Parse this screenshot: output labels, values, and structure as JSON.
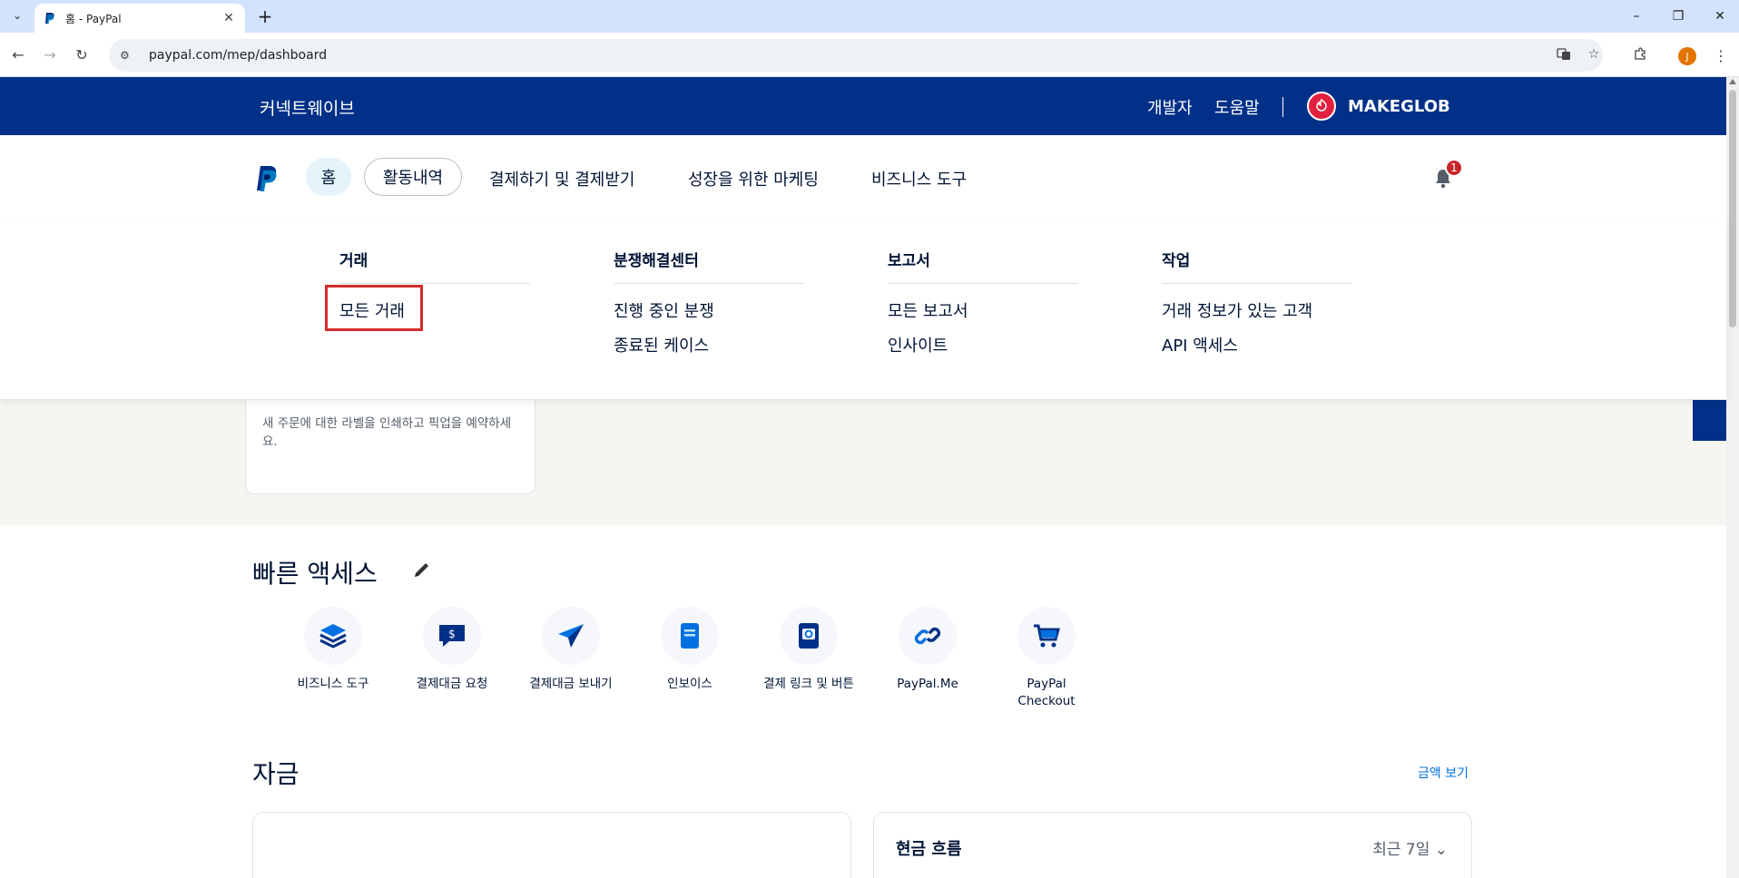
{
  "browser": {
    "tab_title": "홈 - PayPal",
    "url": "paypal.com/mep/dashboard",
    "profile_initial": "J"
  },
  "topbar": {
    "brand": "커넥트웨이브",
    "developer": "개발자",
    "help": "도움말",
    "merchant": "MAKEGLOB"
  },
  "nav": {
    "home": "홈",
    "activity": "활동내역",
    "payments": "결제하기 및 결제받기",
    "marketing": "성장을 위한 마케팅",
    "business_tools": "비즈니스 도구",
    "notifications_count": "1"
  },
  "megamenu": {
    "columns": [
      {
        "title": "거래",
        "items": [
          "모든 거래"
        ]
      },
      {
        "title": "분쟁해결센터",
        "items": [
          "진행 중인 분쟁",
          "종료된 케이스"
        ]
      },
      {
        "title": "보고서",
        "items": [
          "모든 보고서",
          "인사이트"
        ]
      },
      {
        "title": "작업",
        "items": [
          "거래 정보가 있는 고객",
          "API 액세스"
        ]
      }
    ]
  },
  "shipping_card": {
    "description": "새 주문에 대한 라벨을 인쇄하고 픽업을 예약하세요."
  },
  "quick_access": {
    "title": "빠른 액세스",
    "items": [
      {
        "label": "비즈니스 도구",
        "icon": "layers-icon"
      },
      {
        "label": "결제대금 요청",
        "icon": "request-money-icon"
      },
      {
        "label": "결제대금 보내기",
        "icon": "send-money-icon"
      },
      {
        "label": "인보이스",
        "icon": "invoice-icon"
      },
      {
        "label": "결제 링크 및 버튼",
        "icon": "payment-link-icon"
      },
      {
        "label": "PayPal.Me",
        "icon": "link-icon"
      },
      {
        "label": "PayPal Checkout",
        "icon": "cart-icon"
      }
    ]
  },
  "funds": {
    "title": "자금",
    "view_amount": "금액 보기",
    "cash_flow_title": "현금 흐름",
    "cash_flow_period": "최근 7일"
  },
  "colors": {
    "topbar": "#003087",
    "accent": "#0070e0",
    "highlight": "#d32c2c"
  }
}
